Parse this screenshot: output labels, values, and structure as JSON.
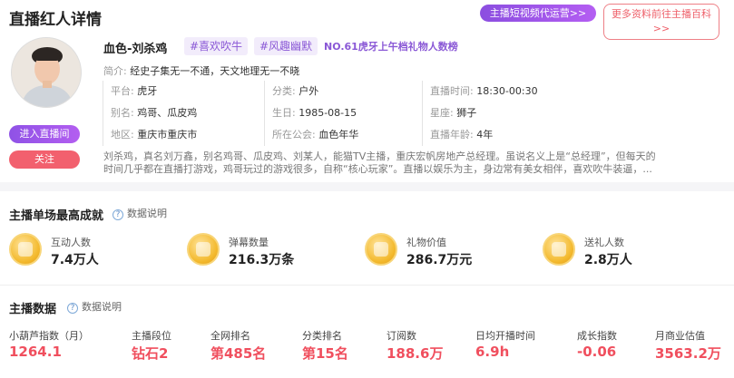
{
  "header": {
    "title": "直播红人详情",
    "promo_label": "主播短视频代运营>>",
    "more_line1": "更多资料前往主播百科",
    "more_line2": ">>"
  },
  "profile": {
    "name": "血色-刘杀鸡",
    "tags": [
      "#喜欢吹牛",
      "#风趣幽默"
    ],
    "rank_text": "NO.61虎牙上午档礼物人数榜",
    "intro_label": "简介:",
    "intro_text": "经史子集无一不通，天文地理无一不晓",
    "enter_button": "进入直播间",
    "follow_button": "关注",
    "info": {
      "platform_label": "平台:",
      "platform": "虎牙",
      "category_label": "分类:",
      "category": "户外",
      "time_label": "直播时间:",
      "time": "18:30-00:30",
      "alias_label": "别名:",
      "alias": "鸡哥、瓜皮鸡",
      "birthday_label": "生日:",
      "birthday": "1985-08-15",
      "sign_label": "星座:",
      "sign": "狮子",
      "region_label": "地区:",
      "region": "重庆市重庆市",
      "guild_label": "所在公会:",
      "guild": "血色年华",
      "age_label": "直播年龄:",
      "age": "4年"
    },
    "description_line1": "刘杀鸡，真名刘万鑫，别名鸡哥、瓜皮鸡、刘某人，能猫TV主播，重庆宏帆房地产总经理。虽说名义上是“总经理”，但每天的",
    "description_line2": "时间几乎都在直播打游戏，鸡哥玩过的游戏很多，自称“核心玩家”。直播以娱乐为主，身边常有美女相伴，喜欢吹牛装逼，..."
  },
  "achievements": {
    "title": "主播单场最高成就",
    "help_label": "数据说明",
    "items": [
      {
        "label": "互动人数",
        "value": "7.4万人"
      },
      {
        "label": "弹幕数量",
        "value": "216.3万条"
      },
      {
        "label": "礼物价值",
        "value": "286.7万元"
      },
      {
        "label": "送礼人数",
        "value": "2.8万人"
      }
    ]
  },
  "metrics": {
    "title": "主播数据",
    "help_label": "数据说明",
    "items": [
      {
        "label": "小葫芦指数（月）",
        "value": "1264.1"
      },
      {
        "label": "主播段位",
        "value": "钻石2"
      },
      {
        "label": "全网排名",
        "value": "第485名"
      },
      {
        "label": "分类排名",
        "value": "第15名"
      },
      {
        "label": "订阅数",
        "value": "188.6万"
      },
      {
        "label": "日均开播时间",
        "value": "6.9h"
      },
      {
        "label": "成长指数",
        "value": "-0.06"
      },
      {
        "label": "月商业估值",
        "value": "3563.2万"
      }
    ]
  },
  "colors": {
    "accent_purple": "#8a58d6",
    "accent_red": "#f04f5e",
    "follow_button": "#f2606e"
  }
}
